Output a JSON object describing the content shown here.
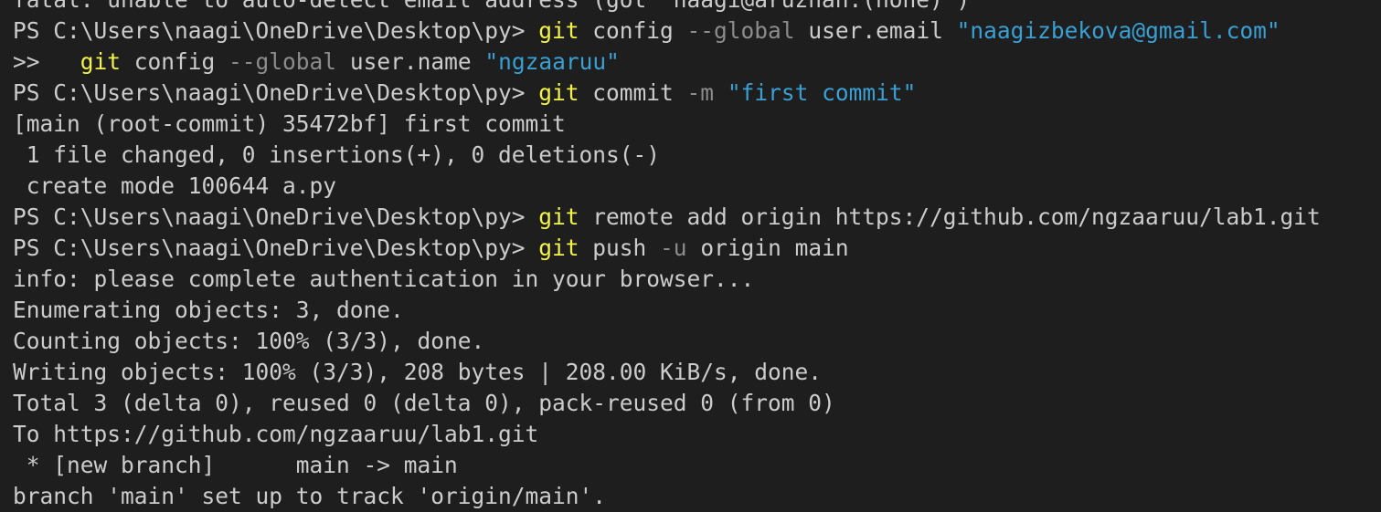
{
  "terminal": {
    "colors": {
      "background": "#1e1e1e",
      "text": "#cccccc",
      "command": "#f2f24b",
      "parameter": "#8c8c8c",
      "string": "#3aa0d4"
    },
    "lines": [
      [
        {
          "t": "fatal: unable to auto-detect email address (got 'naagi@aruzhan.(none)')",
          "c": "plain"
        }
      ],
      [
        {
          "t": "PS C:\\Users\\naagi\\OneDrive\\Desktop\\py> ",
          "c": "plain"
        },
        {
          "t": "git",
          "c": "cmd"
        },
        {
          "t": " config ",
          "c": "plain"
        },
        {
          "t": "--global",
          "c": "param"
        },
        {
          "t": " user.email ",
          "c": "plain"
        },
        {
          "t": "\"naagizbekova@gmail.com\"",
          "c": "string"
        }
      ],
      [
        {
          "t": ">>   ",
          "c": "plain"
        },
        {
          "t": "git",
          "c": "cmd"
        },
        {
          "t": " config ",
          "c": "plain"
        },
        {
          "t": "--global",
          "c": "param"
        },
        {
          "t": " user.name ",
          "c": "plain"
        },
        {
          "t": "\"ngzaaruu\"",
          "c": "string"
        }
      ],
      [
        {
          "t": "PS C:\\Users\\naagi\\OneDrive\\Desktop\\py> ",
          "c": "plain"
        },
        {
          "t": "git",
          "c": "cmd"
        },
        {
          "t": " commit ",
          "c": "plain"
        },
        {
          "t": "-m",
          "c": "param"
        },
        {
          "t": " ",
          "c": "plain"
        },
        {
          "t": "\"first commit\"",
          "c": "string"
        }
      ],
      [
        {
          "t": "[main (root-commit) 35472bf] first commit",
          "c": "plain"
        }
      ],
      [
        {
          "t": " 1 file changed, 0 insertions(+), 0 deletions(-)",
          "c": "plain"
        }
      ],
      [
        {
          "t": " create mode 100644 a.py",
          "c": "plain"
        }
      ],
      [
        {
          "t": "PS C:\\Users\\naagi\\OneDrive\\Desktop\\py> ",
          "c": "plain"
        },
        {
          "t": "git",
          "c": "cmd"
        },
        {
          "t": " remote add origin https://github.com/ngzaaruu/lab1.git",
          "c": "plain"
        }
      ],
      [
        {
          "t": "PS C:\\Users\\naagi\\OneDrive\\Desktop\\py> ",
          "c": "plain"
        },
        {
          "t": "git",
          "c": "cmd"
        },
        {
          "t": " push ",
          "c": "plain"
        },
        {
          "t": "-u",
          "c": "param"
        },
        {
          "t": " origin main",
          "c": "plain"
        }
      ],
      [
        {
          "t": "info: please complete authentication in your browser...",
          "c": "plain"
        }
      ],
      [
        {
          "t": "Enumerating objects: 3, done.",
          "c": "plain"
        }
      ],
      [
        {
          "t": "Counting objects: 100% (3/3), done.",
          "c": "plain"
        }
      ],
      [
        {
          "t": "Writing objects: 100% (3/3), 208 bytes | 208.00 KiB/s, done.",
          "c": "plain"
        }
      ],
      [
        {
          "t": "Total 3 (delta 0), reused 0 (delta 0), pack-reused 0 (from 0)",
          "c": "plain"
        }
      ],
      [
        {
          "t": "To https://github.com/ngzaaruu/lab1.git",
          "c": "plain"
        }
      ],
      [
        {
          "t": " * [new branch]      main -> main",
          "c": "plain"
        }
      ],
      [
        {
          "t": "branch 'main' set up to track 'origin/main'.",
          "c": "plain"
        }
      ]
    ]
  }
}
